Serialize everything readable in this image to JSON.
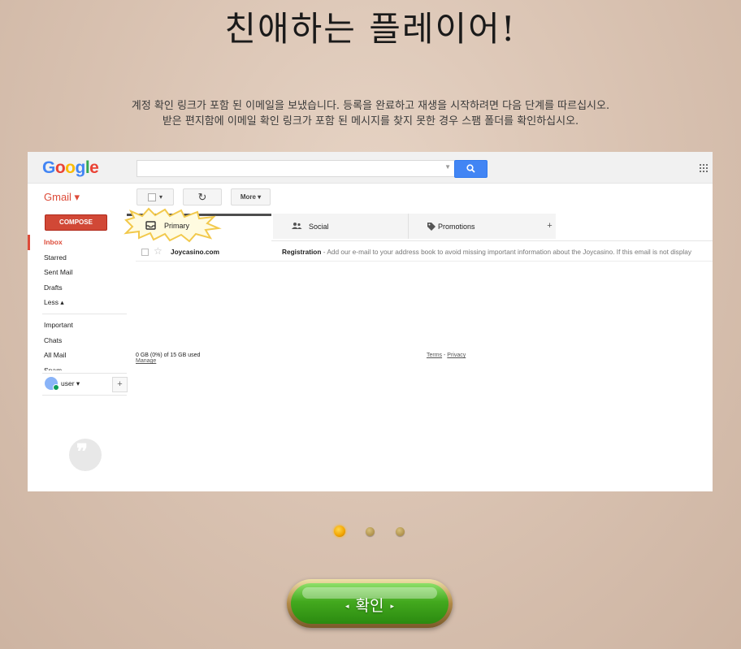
{
  "title": "친애하는 플레이어!",
  "description": {
    "line1": "계정 확인 링크가 포함 된 이메일을 보냈습니다. 등록을 완료하고 재생을 시작하려면 다음 단계를 따르십시오.",
    "line2": "받은 편지함에 이메일 확인 링크가 포함 된 메시지를 찾지 못한 경우 스팸 폴더를 확인하십시오."
  },
  "gmail": {
    "logo": [
      "G",
      "o",
      "o",
      "g",
      "l",
      "e"
    ],
    "app_label": "Gmail ▾",
    "toolbar": {
      "select_arrow": "▾",
      "refresh": "↻",
      "more": "More ▾"
    },
    "compose": "COMPOSE",
    "nav": [
      "Inbox",
      "Starred",
      "Sent Mail",
      "Drafts",
      "Less ▴"
    ],
    "nav2": [
      "Important",
      "Chats",
      "All Mail",
      "Spam"
    ],
    "user": "user ▾",
    "user_plus": "+",
    "tabs": {
      "primary": "Primary",
      "social": "Social",
      "promotions": "Promotions",
      "add": "+"
    },
    "email": {
      "from": "Joycasino.com",
      "subject": "Registration",
      "snippet": " - Add our e-mail to your address book to avoid missing important information about the Joycasino. If this email is not display"
    },
    "footer": {
      "storage": "0 GB (0%) of 15 GB used",
      "manage": "Manage",
      "terms": "Terms",
      "sep": " - ",
      "privacy": "Privacy"
    },
    "hangouts_glyph": "❞"
  },
  "carousel": {
    "count": 3,
    "active": 0
  },
  "confirm_button": {
    "label": "확인",
    "left_arrow": "◂",
    "right_arrow": "▸"
  },
  "colors": {
    "gmail_red": "#dd4b39",
    "google_blue": "#4285f4",
    "button_green": "#43a91e",
    "active_dot": "#f2a400"
  }
}
